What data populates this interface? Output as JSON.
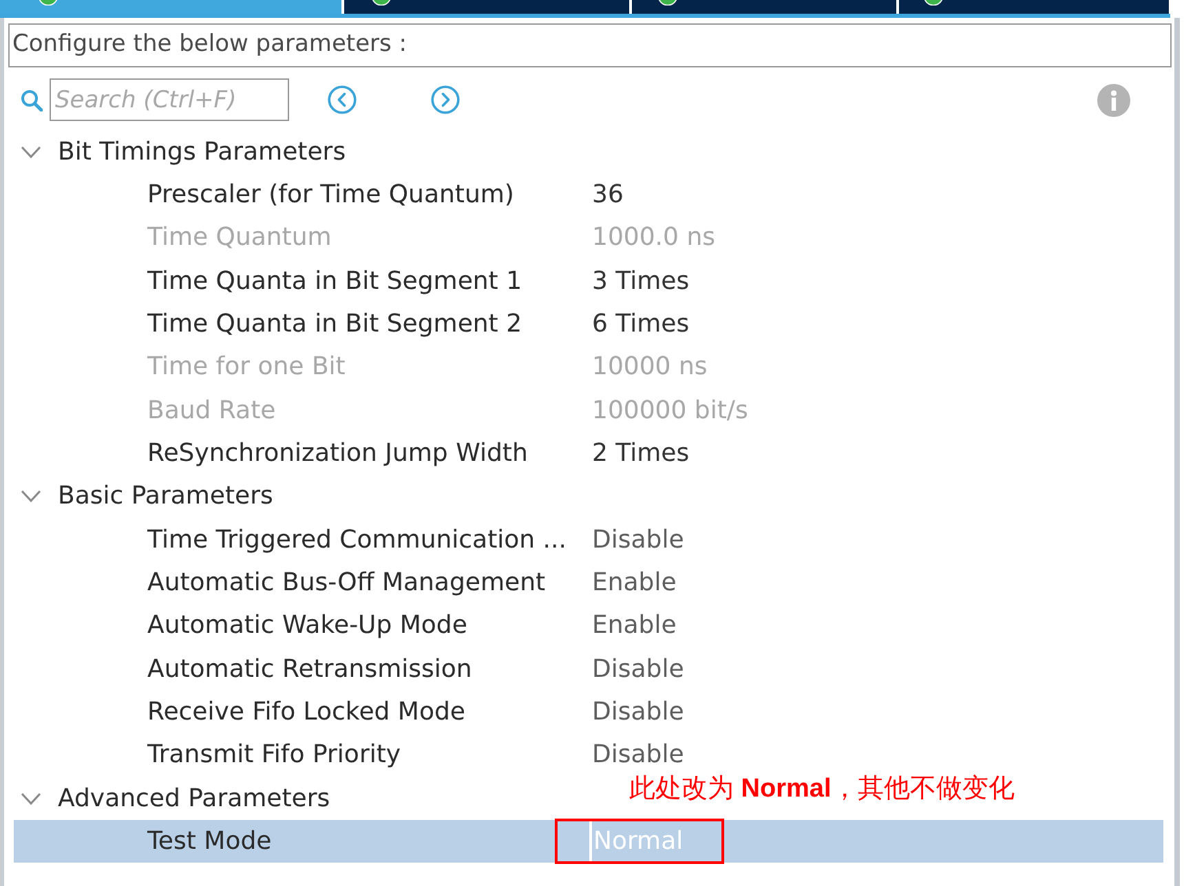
{
  "tabs": [
    {
      "selected": true
    },
    {
      "selected": false
    },
    {
      "selected": false
    },
    {
      "selected": false
    }
  ],
  "description": "Configure the below parameters :",
  "search": {
    "placeholder": "Search (Ctrl+F)"
  },
  "groups": [
    {
      "label": "Bit Timings Parameters",
      "expanded": true,
      "children": [
        {
          "label": "Prescaler (for Time Quantum)",
          "value": "36",
          "kind": "text",
          "disabled": false,
          "selected": false
        },
        {
          "label": "Time Quantum",
          "value": "1000.0 ns",
          "kind": "text",
          "disabled": true,
          "selected": false
        },
        {
          "label": "Time Quanta in Bit Segment 1",
          "value": "3 Times",
          "kind": "text",
          "disabled": false,
          "selected": false
        },
        {
          "label": "Time Quanta in Bit Segment 2",
          "value": "6 Times",
          "kind": "text",
          "disabled": false,
          "selected": false
        },
        {
          "label": "Time for one Bit",
          "value": "10000 ns",
          "kind": "text",
          "disabled": true,
          "selected": false
        },
        {
          "label": "Baud Rate",
          "value": "100000 bit/s",
          "kind": "text",
          "disabled": true,
          "selected": false
        },
        {
          "label": "ReSynchronization Jump Width",
          "value": "2 Times",
          "kind": "text",
          "disabled": false,
          "selected": false
        }
      ]
    },
    {
      "label": "Basic Parameters",
      "expanded": true,
      "children": [
        {
          "label": "Time Triggered Communication ...",
          "value": "Disable",
          "kind": "choice",
          "disabled": false,
          "selected": false
        },
        {
          "label": "Automatic Bus-Off Management",
          "value": "Enable",
          "kind": "choice",
          "disabled": false,
          "selected": false
        },
        {
          "label": "Automatic Wake-Up Mode",
          "value": "Enable",
          "kind": "choice",
          "disabled": false,
          "selected": false
        },
        {
          "label": "Automatic Retransmission",
          "value": "Disable",
          "kind": "choice",
          "disabled": false,
          "selected": false
        },
        {
          "label": "Receive Fifo Locked Mode",
          "value": "Disable",
          "kind": "choice",
          "disabled": false,
          "selected": false
        },
        {
          "label": "Transmit Fifo Priority",
          "value": "Disable",
          "kind": "choice",
          "disabled": false,
          "selected": false
        }
      ]
    },
    {
      "label": "Advanced Parameters",
      "expanded": true,
      "children": [
        {
          "label": "Test Mode",
          "value": "Normal",
          "kind": "choice",
          "disabled": false,
          "selected": true,
          "annotation": "此处改为 **Normal**，其他不做变化"
        }
      ]
    }
  ]
}
